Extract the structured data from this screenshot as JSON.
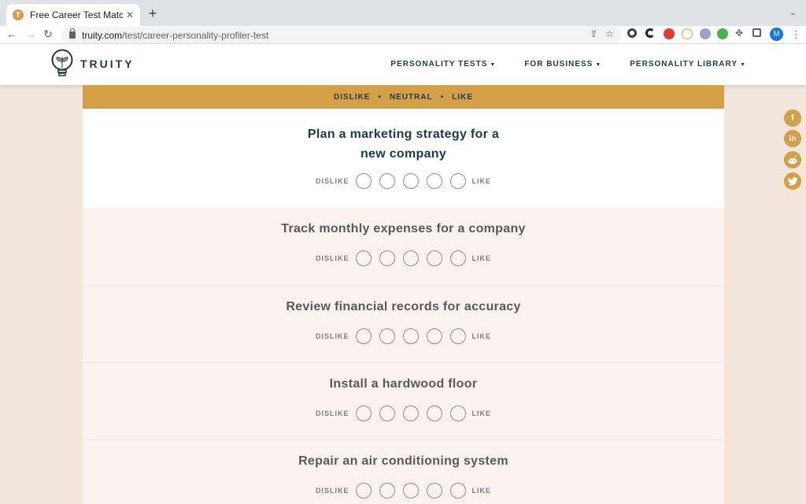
{
  "browser": {
    "tab_title": "Free Career Test Matches Your",
    "tab_favicon": "T",
    "tab_close": "✕",
    "new_tab": "+",
    "url_domain": "truity.com",
    "url_path": "/test/career-personality-profiler-test",
    "profile_initial": "M"
  },
  "site": {
    "logo_text": "TRUITY",
    "nav": [
      {
        "label": "PERSONALITY TESTS"
      },
      {
        "label": "FOR BUSINESS"
      },
      {
        "label": "PERSONALITY LIBRARY"
      }
    ]
  },
  "scale_header": {
    "left": "DISLIKE",
    "middle": "NEUTRAL",
    "right": "LIKE",
    "sep": "•"
  },
  "questions": [
    {
      "text": "Plan a marketing strategy for a new company",
      "left": "DISLIKE",
      "right": "LIKE"
    },
    {
      "text": "Track monthly expenses for a company",
      "left": "DISLIKE",
      "right": "LIKE"
    },
    {
      "text": "Review financial records for accuracy",
      "left": "DISLIKE",
      "right": "LIKE"
    },
    {
      "text": "Install a hardwood floor",
      "left": "DISLIKE",
      "right": "LIKE"
    },
    {
      "text": "Repair an air conditioning system",
      "left": "DISLIKE",
      "right": "LIKE"
    }
  ],
  "colors": {
    "accent": "#d4a047",
    "navy": "#1d3b47",
    "alt_row": "#fcf3ee",
    "page_bg": "#f3e6dc"
  },
  "social": [
    "facebook-icon",
    "linkedin-icon",
    "reddit-icon",
    "twitter-icon"
  ]
}
